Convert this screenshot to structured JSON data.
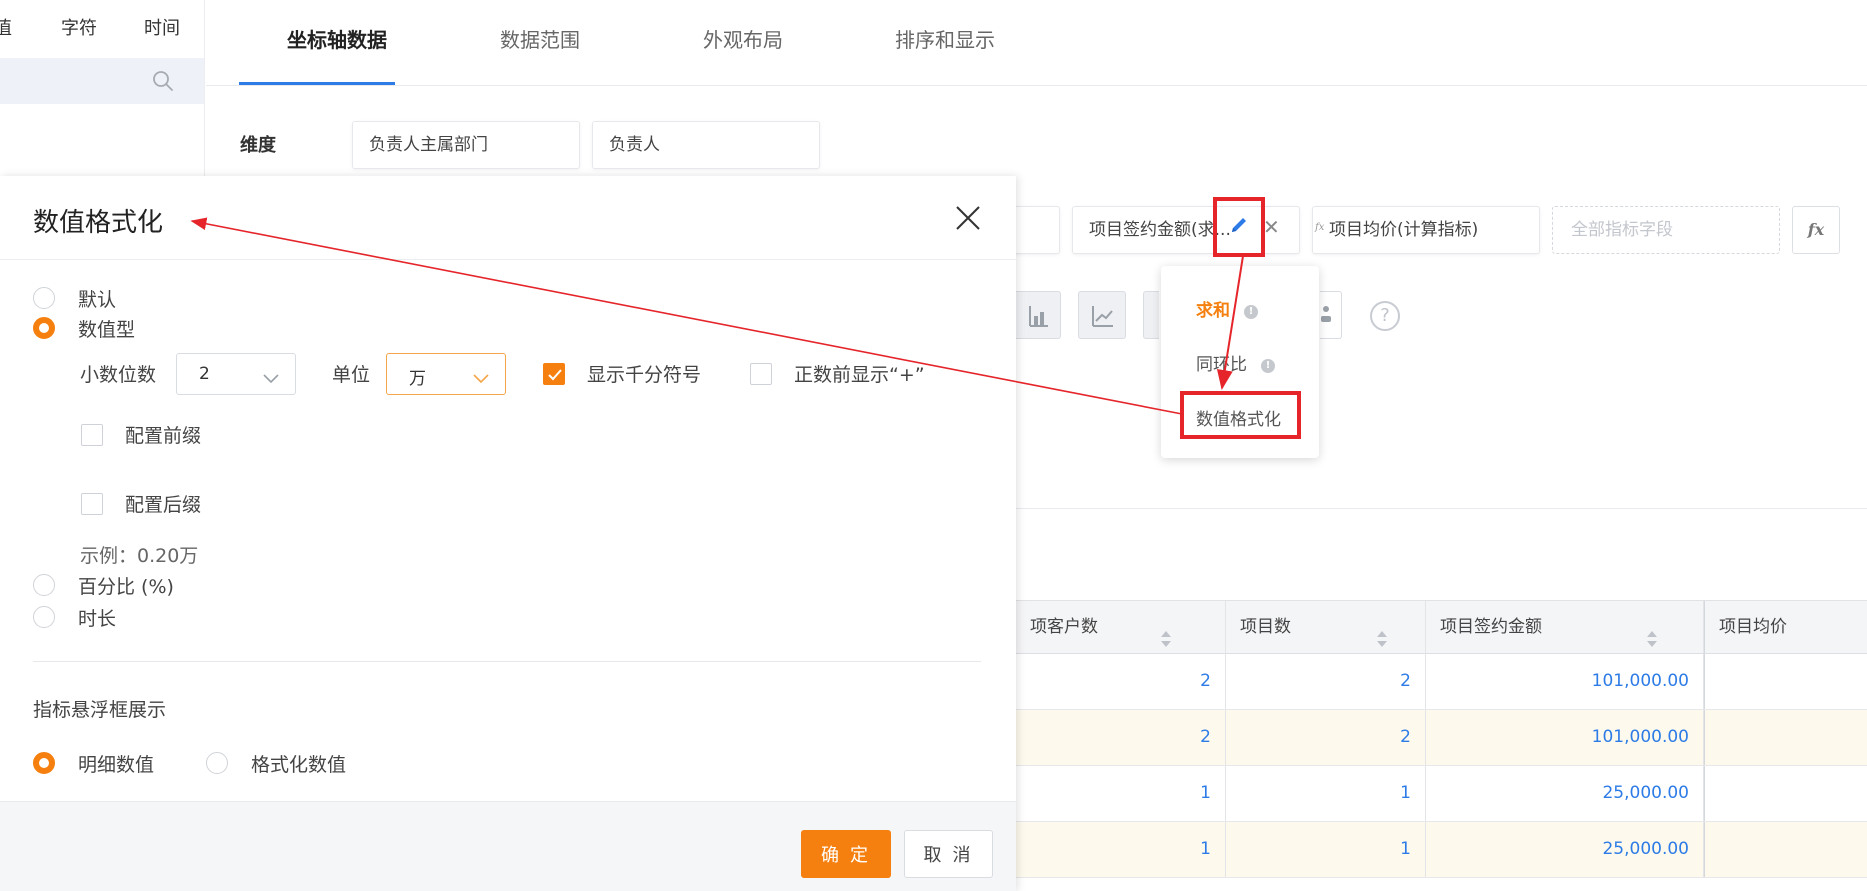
{
  "left_panel": {
    "type_tabs": [
      "值",
      "字符",
      "时间"
    ]
  },
  "tabs": [
    {
      "label": "坐标轴数据"
    },
    {
      "label": "数据范围"
    },
    {
      "label": "外观布局"
    },
    {
      "label": "排序和显示"
    }
  ],
  "config": {
    "dimension_label": "维度",
    "dimension_chips": [
      "负责人主属部门",
      "负责人"
    ],
    "metric_chips": [
      "项目签约金额(求...",
      "项目均价(计算指标)"
    ],
    "metric_placeholder": "全部指标字段",
    "fx_corner": "fx",
    "fx_button": "fx",
    "help": "?"
  },
  "agg_menu": {
    "items": [
      "求和",
      "同环比",
      "数值格式化"
    ],
    "info_glyph": "!"
  },
  "table": {
    "columns": [
      "项客户数",
      "项目数",
      "项目签约金额",
      "项目均价"
    ],
    "rows": [
      [
        "2",
        "2",
        "101,000.00",
        ""
      ],
      [
        "2",
        "2",
        "101,000.00",
        ""
      ],
      [
        "1",
        "1",
        "25,000.00",
        ""
      ],
      [
        "1",
        "1",
        "25,000.00",
        ""
      ]
    ]
  },
  "modal": {
    "title": "数值格式化",
    "options": {
      "default": "默认",
      "numeric": "数值型",
      "percent": "百分比 (%)",
      "duration": "时长"
    },
    "decimal_label": "小数位数",
    "decimal_value": "2",
    "unit_label": "单位",
    "unit_value": "万",
    "thousands_label": "显示千分符号",
    "positive_plus_label": "正数前显示“+”",
    "prefix_label": "配置前缀",
    "suffix_label": "配置后缀",
    "example_text": "示例：0.20万",
    "tooltip_section_title": "指标悬浮框展示",
    "tooltip_detail": "明细数值",
    "tooltip_formatted": "格式化数值",
    "confirm": "确 定",
    "cancel": "取 消"
  },
  "colors": {
    "accent": "#f5800f",
    "link_blue": "#2d7be6",
    "annotation_red": "#e5252a"
  }
}
